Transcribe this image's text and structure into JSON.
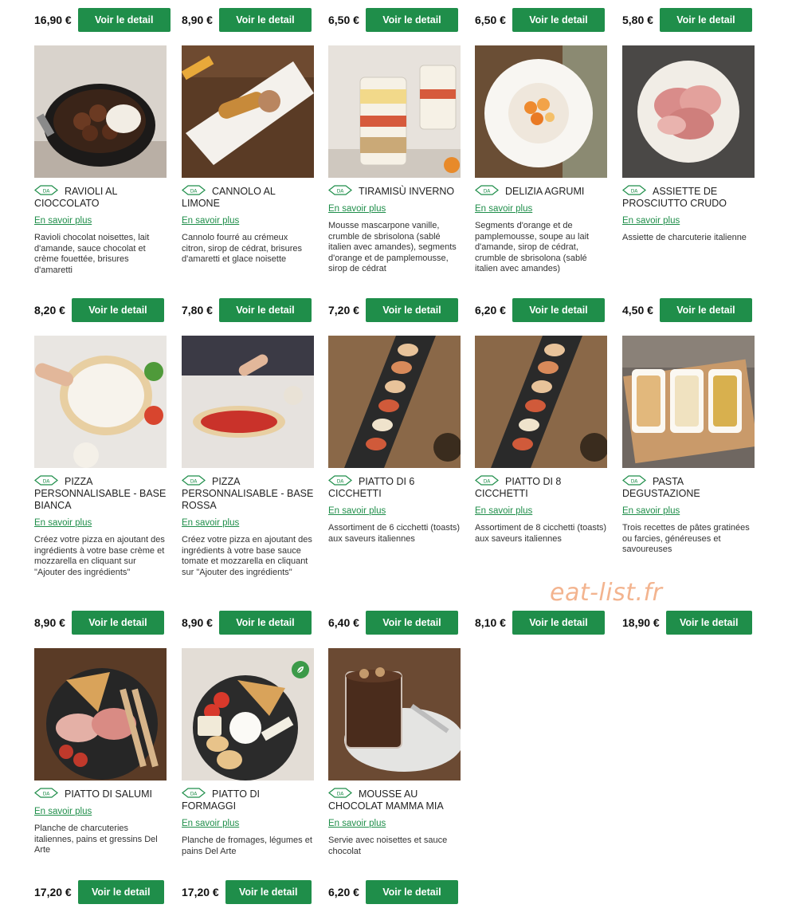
{
  "button_label": "Voir le detail",
  "more_label": "En savoir plus",
  "watermark": "eat-list.fr",
  "logo_text": "DA",
  "brand_color": "#1f8e4a",
  "price_rows": [
    [
      "16,90 €",
      "8,90 €",
      "6,50 €",
      "6,50 €",
      "5,80 €"
    ],
    [
      "8,20 €",
      "7,80 €",
      "7,20 €",
      "6,20 €",
      "4,50 €"
    ],
    [
      "8,90 €",
      "8,90 €",
      "6,40 €",
      "8,10 €",
      "18,90 €"
    ],
    [
      "17,20 €",
      "17,20 €",
      "6,20 €"
    ]
  ],
  "products": [
    {
      "name": "RAVIOLI AL CIOCCOLATO",
      "image": "chocolate-ravioli-bowl",
      "description": "Ravioli chocolat noisettes, lait d'amande, sauce chocolat et crème fouettée, brisures d'amaretti"
    },
    {
      "name": "CANNOLO AL LIMONE",
      "image": "cannolo-plate",
      "description": "Cannolo fourré au crémeux citron, sirop de cédrat, brisures d'amaretti et glace noisette"
    },
    {
      "name": "TIRAMISÙ INVERNO",
      "image": "tiramisu-glass",
      "description": "Mousse mascarpone vanille, crumble de sbrisolona (sablé italien avec amandes), segments d'orange et de pamplemousse, sirop de cédrat"
    },
    {
      "name": "DELIZIA AGRUMI",
      "image": "citrus-dessert-plate",
      "description": "Segments d'orange et de pamplemousse, soupe au lait d'amande, sirop de cédrat, crumble de sbrisolona (sablé italien avec amandes)"
    },
    {
      "name": "ASSIETTE DE PROSCIUTTO CRUDO",
      "image": "prosciutto-plate",
      "description": "Assiette de charcuterie italienne"
    },
    {
      "name": "PIZZA PERSONNALISABLE - BASE BIANCA",
      "image": "white-pizza-base",
      "description": "Créez votre pizza en ajoutant des ingrédients à votre base crème et mozzarella en cliquant sur \"Ajouter des ingrédients\""
    },
    {
      "name": "PIZZA PERSONNALISABLE - BASE ROSSA",
      "image": "red-pizza-base",
      "description": "Créez votre pizza en ajoutant des ingrédients à votre base sauce tomate et mozzarella en cliquant sur \"Ajouter des ingrédients\""
    },
    {
      "name": "PIATTO DI 6 CICCHETTI",
      "image": "cicchetti-board",
      "description": "Assortiment de 6 cicchetti (toasts) aux saveurs italiennes"
    },
    {
      "name": "PIATTO DI 8 CICCHETTI",
      "image": "cicchetti-board",
      "description": "Assortiment de 8 cicchetti (toasts) aux saveurs italiennes"
    },
    {
      "name": "PASTA DEGUSTAZIONE",
      "image": "pasta-trio",
      "description": "Trois recettes de pâtes gratinées ou farcies, généreuses et savoureuses"
    },
    {
      "name": "PIATTO DI SALUMI",
      "image": "salumi-board",
      "description": "Planche de charcuteries italiennes, pains et gressins Del Arte"
    },
    {
      "name": "PIATTO DI FORMAGGI",
      "image": "cheese-board",
      "description": "Planche de fromages, légumes et pains Del Arte",
      "vegetarian_icon": "leaf-icon"
    },
    {
      "name": "MOUSSE AU CHOCOLAT MAMMA MIA",
      "image": "chocolate-mousse-glass",
      "description": "Servie avec noisettes et sauce chocolat"
    }
  ]
}
